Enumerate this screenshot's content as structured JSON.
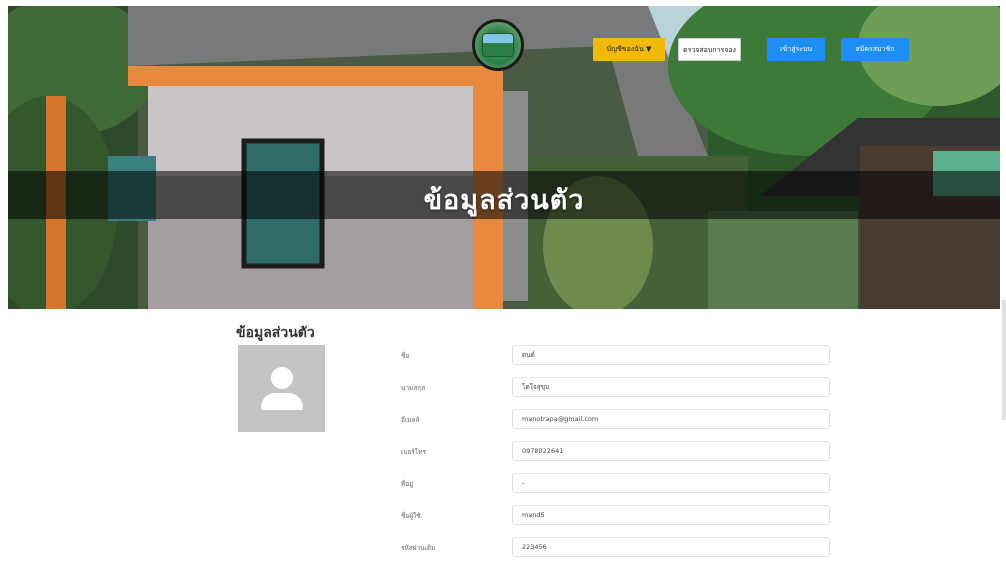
{
  "header": {
    "nav_links": [
      "",
      "",
      "",
      "",
      ""
    ],
    "account_button": "บัญชีของฉัน ▼",
    "booking_button": "ตรวจสอบการจอง",
    "login_button": "เข้าสู่ระบบ",
    "register_button": "สมัครสมาชิก"
  },
  "hero": {
    "title": "ข้อมูลส่วนตัว"
  },
  "profile": {
    "section_title": "ข้อมูลส่วนตัว",
    "fields": [
      {
        "label": "ชื่อ",
        "value": "ตนต์"
      },
      {
        "label": "นามสกุล",
        "value": "โตใจสุขุม"
      },
      {
        "label": "อีเมลล์",
        "value": "manotrapa@gmail.com"
      },
      {
        "label": "เบอร์โทร",
        "value": "0978022641"
      },
      {
        "label": "ที่อยู่",
        "value": "-"
      },
      {
        "label": "ชื่อผู้ใช้",
        "value": "mand5"
      },
      {
        "label": "รหัสผ่านเดิม",
        "value": "223456"
      }
    ]
  },
  "colors": {
    "account_button": "#f0b90b",
    "primary_button": "#1e8ff2",
    "avatar_bg": "#c4c4c4"
  },
  "icons": {
    "avatar": "user-placeholder-icon",
    "logo": "resort-logo"
  }
}
